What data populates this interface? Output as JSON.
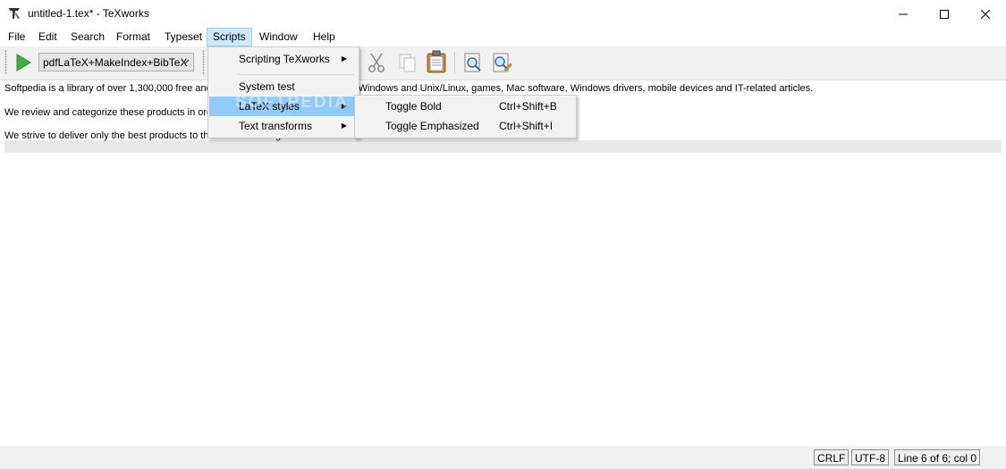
{
  "window": {
    "title": "untitled-1.tex* - TeXworks",
    "minimize_icon": "minimize-icon",
    "maximize_icon": "maximize-icon",
    "close_icon": "close-icon"
  },
  "menubar": {
    "items": [
      {
        "label": "File"
      },
      {
        "label": "Edit"
      },
      {
        "label": "Search"
      },
      {
        "label": "Format"
      },
      {
        "label": "Typeset"
      },
      {
        "label": "Scripts"
      },
      {
        "label": "Window"
      },
      {
        "label": "Help"
      }
    ],
    "active": "Scripts"
  },
  "toolbar": {
    "typeset_icon": "play-icon",
    "engine_selected": "pdfLaTeX+MakeIndex+BibTeX",
    "buttons": [
      "cut-icon",
      "copy-icon",
      "paste-icon",
      "find-icon",
      "replace-icon"
    ]
  },
  "editor": {
    "lines": [
      "Softpedia is a library of over 1,300,000 free and free-to-try software programs for Windows and Unix/Linux, games, Mac software, Windows drivers, mobile devices and IT-related articles.",
      "We review and categorize these products in order to allow the visitor/user to find the exact product they and their system needs.",
      "We strive to deliver only the best products to the visitor/user together with self-made evaluation and review notes."
    ]
  },
  "scripts_menu": {
    "items": [
      {
        "label": "Scripting TeXworks",
        "has_submenu": true
      },
      {
        "label": "System test",
        "has_submenu": false
      },
      {
        "label": "LaTeX styles",
        "has_submenu": true,
        "highlighted": true
      },
      {
        "label": "Text transforms",
        "has_submenu": true
      }
    ]
  },
  "latex_styles_submenu": {
    "items": [
      {
        "label": "Toggle Bold",
        "shortcut": "Ctrl+Shift+B"
      },
      {
        "label": "Toggle Emphasized",
        "shortcut": "Ctrl+Shift+I"
      }
    ]
  },
  "watermark": "SOFTPEDIA",
  "statusbar": {
    "line_ending": "CRLF",
    "encoding": "UTF-8",
    "position": "Line 6 of 6; col 0"
  },
  "colors": {
    "menu_highlight": "#91c9f7",
    "active_menu_bg": "#cce8ff",
    "typeset_green": "#3cb043"
  }
}
